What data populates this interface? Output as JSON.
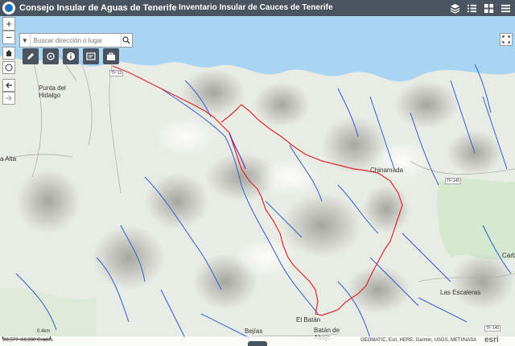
{
  "header": {
    "app_title": "Consejo Insular de Aguas de Tenerife",
    "map_title": "Inventario Insular de Cauces de Tenerife"
  },
  "search": {
    "placeholder": "Buscar dirección o lugar"
  },
  "map_labels": {
    "punta_del_hidalgo": "Punta del\nHidalgo",
    "alta": "a Alta",
    "chinamada": "Chinamada",
    "las_escaleras": "Las Escaleras",
    "el_batan": "El Batán",
    "batan_de_abajo": "Batán de\nAbajo",
    "bejias": "Bejías",
    "carbo": "Carbo",
    "road_tf13": "TF-13",
    "road_tf145_a": "TF-145",
    "road_tf145_b": "TF-145"
  },
  "footer": {
    "scale": "0.4km",
    "coords": "28,577 -16,330 Grados",
    "attribution": "GEOMATIC, Esri, HERE, Garmin, USGS, METI/NASA",
    "esri": "esri"
  },
  "colors": {
    "header_bg": "#4a5460",
    "sea": "#a9d4f2",
    "stream": "#2f5fd0",
    "route": "#e0262b"
  }
}
